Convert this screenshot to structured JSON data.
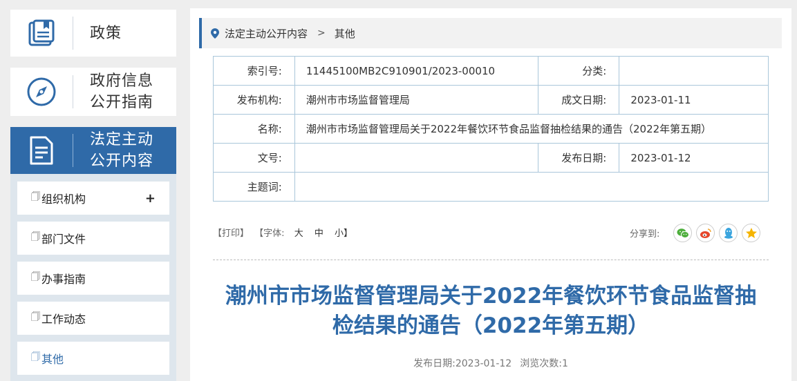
{
  "sidebar": {
    "categories": [
      {
        "label_line1": "政策",
        "label_line2": "",
        "icon": "book-icon"
      },
      {
        "label_line1": "政府信息",
        "label_line2": "公开指南",
        "icon": "compass-icon"
      },
      {
        "label_line1": "法定主动",
        "label_line2": "公开内容",
        "icon": "document-icon"
      }
    ],
    "subitems": [
      {
        "label": "组织机构",
        "expand": "+"
      },
      {
        "label": "部门文件"
      },
      {
        "label": "办事指南"
      },
      {
        "label": "工作动态"
      },
      {
        "label": "其他"
      }
    ],
    "doc_glyph": "🗍"
  },
  "breadcrumb": {
    "items": [
      "法定主动公开内容",
      "其他"
    ],
    "separator": ">"
  },
  "meta": {
    "index_no_label": "索引号:",
    "index_no": "11445100MB2C910901/2023-00010",
    "category_label": "分类:",
    "category": "",
    "issuer_label": "发布机构:",
    "issuer": "潮州市市场监督管理局",
    "written_date_label": "成文日期:",
    "written_date": "2023-01-11",
    "name_label": "名称:",
    "name": "潮州市市场监督管理局关于2022年餐饮环节食品监督抽检结果的通告（2022年第五期）",
    "doc_no_label": "文号:",
    "doc_no": "",
    "publish_date_label": "发布日期:",
    "publish_date": "2023-01-12",
    "keywords_label": "主题词:",
    "keywords": ""
  },
  "tools": {
    "print": "【打印】",
    "font_label": "【字体:",
    "font_large": "大",
    "font_medium": "中",
    "font_small": "小】",
    "share_label": "分享到:"
  },
  "share_icons": [
    "wechat-icon",
    "weibo-icon",
    "qq-icon",
    "qzone-icon"
  ],
  "colors": {
    "accent": "#2f6aa8",
    "wechat": "#4cae3b",
    "weibo": "#e5462b",
    "qq": "#3ba5de",
    "qzone": "#f5b400"
  },
  "article": {
    "title_line1": "潮州市市场监督管理局关于2022年餐饮环节食品监督抽",
    "title_line2": "检结果的通告（2022年第五期）",
    "pub_date_label": "发布日期:",
    "pub_date": "2023-01-12",
    "views_label": "浏览次数:",
    "views": "1"
  }
}
